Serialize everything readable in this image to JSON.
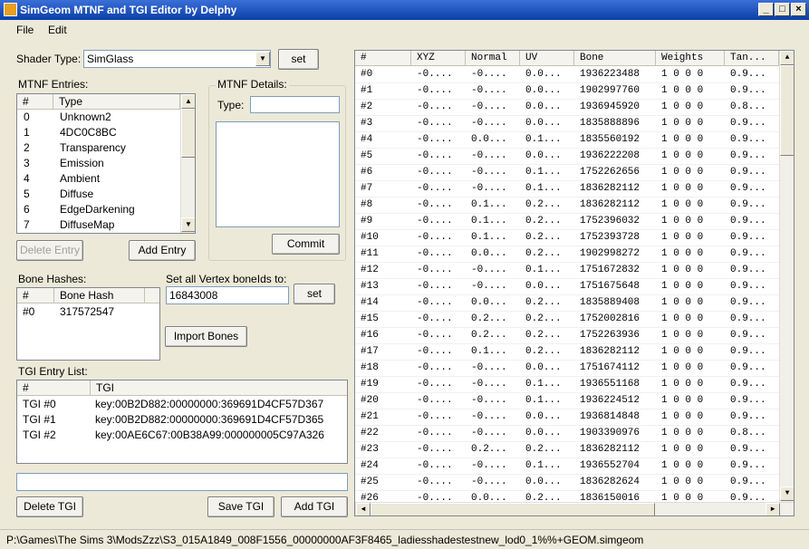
{
  "window": {
    "title": "SimGeom MTNF and TGI Editor by Delphy"
  },
  "menu": [
    "File",
    "Edit"
  ],
  "shader": {
    "label": "Shader Type:",
    "value": "SimGlass",
    "set_label": "set"
  },
  "mtnf_entries": {
    "label": "MTNF Entries:",
    "columns": [
      "#",
      "Type"
    ],
    "rows": [
      [
        "0",
        "Unknown2"
      ],
      [
        "1",
        "4DC0C8BC"
      ],
      [
        "2",
        "Transparency"
      ],
      [
        "3",
        "Emission"
      ],
      [
        "4",
        "Ambient"
      ],
      [
        "5",
        "Diffuse"
      ],
      [
        "6",
        "EdgeDarkening"
      ],
      [
        "7",
        "DiffuseMap"
      ]
    ],
    "delete_label": "Delete Entry",
    "add_label": "Add Entry"
  },
  "mtnf_details": {
    "label": "MTNF Details:",
    "type_label": "Type:",
    "type_value": "",
    "commit_label": "Commit"
  },
  "bone_hashes": {
    "label": "Bone Hashes:",
    "columns": [
      "#",
      "Bone Hash"
    ],
    "rows": [
      [
        "#0",
        "317572547"
      ]
    ]
  },
  "vertex_bones": {
    "label": "Set all Vertex boneIds to:",
    "value": "16843008",
    "set_label": "set",
    "import_label": "Import Bones"
  },
  "tgi": {
    "label": "TGI Entry List:",
    "columns": [
      "#",
      "TGI"
    ],
    "rows": [
      [
        "TGI #0",
        "key:00B2D882:00000000:369691D4CF57D367"
      ],
      [
        "TGI #1",
        "key:00B2D882:00000000:369691D4CF57D365"
      ],
      [
        "TGI #2",
        "key:00AE6C67:00B38A99:000000005C97A326"
      ]
    ],
    "input_value": "",
    "delete_label": "Delete TGI",
    "save_label": "Save TGI",
    "add_label": "Add TGI"
  },
  "vertex_grid": {
    "columns": [
      "#",
      "XYZ",
      "Normal",
      "UV",
      "Bone",
      "Weights",
      "Tan..."
    ],
    "rows": [
      [
        "#0",
        "-0....",
        "-0....",
        "0.0...",
        "1936223488",
        "1 0 0 0",
        "0.9..."
      ],
      [
        "#1",
        "-0....",
        "-0....",
        "0.0...",
        "1902997760",
        "1 0 0 0",
        "0.9..."
      ],
      [
        "#2",
        "-0....",
        "-0....",
        "0.0...",
        "1936945920",
        "1 0 0 0",
        "0.8..."
      ],
      [
        "#3",
        "-0....",
        "-0....",
        "0.0...",
        "1835888896",
        "1 0 0 0",
        "0.9..."
      ],
      [
        "#4",
        "-0....",
        "0.0...",
        "0.1...",
        "1835560192",
        "1 0 0 0",
        "0.9..."
      ],
      [
        "#5",
        "-0....",
        "-0....",
        "0.0...",
        "1936222208",
        "1 0 0 0",
        "0.9..."
      ],
      [
        "#6",
        "-0....",
        "-0....",
        "0.1...",
        "1752262656",
        "1 0 0 0",
        "0.9..."
      ],
      [
        "#7",
        "-0....",
        "-0....",
        "0.1...",
        "1836282112",
        "1 0 0 0",
        "0.9..."
      ],
      [
        "#8",
        "-0....",
        "0.1...",
        "0.2...",
        "1836282112",
        "1 0 0 0",
        "0.9..."
      ],
      [
        "#9",
        "-0....",
        "0.1...",
        "0.2...",
        "1752396032",
        "1 0 0 0",
        "0.9..."
      ],
      [
        "#10",
        "-0....",
        "0.1...",
        "0.2...",
        "1752393728",
        "1 0 0 0",
        "0.9..."
      ],
      [
        "#11",
        "-0....",
        "0.0...",
        "0.2...",
        "1902998272",
        "1 0 0 0",
        "0.9..."
      ],
      [
        "#12",
        "-0....",
        "-0....",
        "0.1...",
        "1751672832",
        "1 0 0 0",
        "0.9..."
      ],
      [
        "#13",
        "-0....",
        "-0....",
        "0.0...",
        "1751675648",
        "1 0 0 0",
        "0.9..."
      ],
      [
        "#14",
        "-0....",
        "0.0...",
        "0.2...",
        "1835889408",
        "1 0 0 0",
        "0.9..."
      ],
      [
        "#15",
        "-0....",
        "0.2...",
        "0.2...",
        "1752002816",
        "1 0 0 0",
        "0.9..."
      ],
      [
        "#16",
        "-0....",
        "0.2...",
        "0.2...",
        "1752263936",
        "1 0 0 0",
        "0.9..."
      ],
      [
        "#17",
        "-0....",
        "0.1...",
        "0.2...",
        "1836282112",
        "1 0 0 0",
        "0.9..."
      ],
      [
        "#18",
        "-0....",
        "-0....",
        "0.0...",
        "1751674112",
        "1 0 0 0",
        "0.9..."
      ],
      [
        "#19",
        "-0....",
        "-0....",
        "0.1...",
        "1936551168",
        "1 0 0 0",
        "0.9..."
      ],
      [
        "#20",
        "-0....",
        "-0....",
        "0.1...",
        "1936224512",
        "1 0 0 0",
        "0.9..."
      ],
      [
        "#21",
        "-0....",
        "-0....",
        "0.0...",
        "1936814848",
        "1 0 0 0",
        "0.9..."
      ],
      [
        "#22",
        "-0....",
        "-0....",
        "0.0...",
        "1903390976",
        "1 0 0 0",
        "0.8..."
      ],
      [
        "#23",
        "-0....",
        "0.2...",
        "0.2...",
        "1836282112",
        "1 0 0 0",
        "0.9..."
      ],
      [
        "#24",
        "-0....",
        "-0....",
        "0.1...",
        "1936552704",
        "1 0 0 0",
        "0.9..."
      ],
      [
        "#25",
        "-0....",
        "-0....",
        "0.0...",
        "1836282624",
        "1 0 0 0",
        "0.9..."
      ],
      [
        "#26",
        "-0....",
        "0.0...",
        "0.2...",
        "1836150016",
        "1 0 0 0",
        "0.9..."
      ]
    ]
  },
  "status": {
    "path": "P:\\Games\\The Sims 3\\ModsZzz\\S3_015A1849_008F1556_00000000AF3F8465_ladiesshadestestnew_lod0_1%%+GEOM.simgeom"
  }
}
